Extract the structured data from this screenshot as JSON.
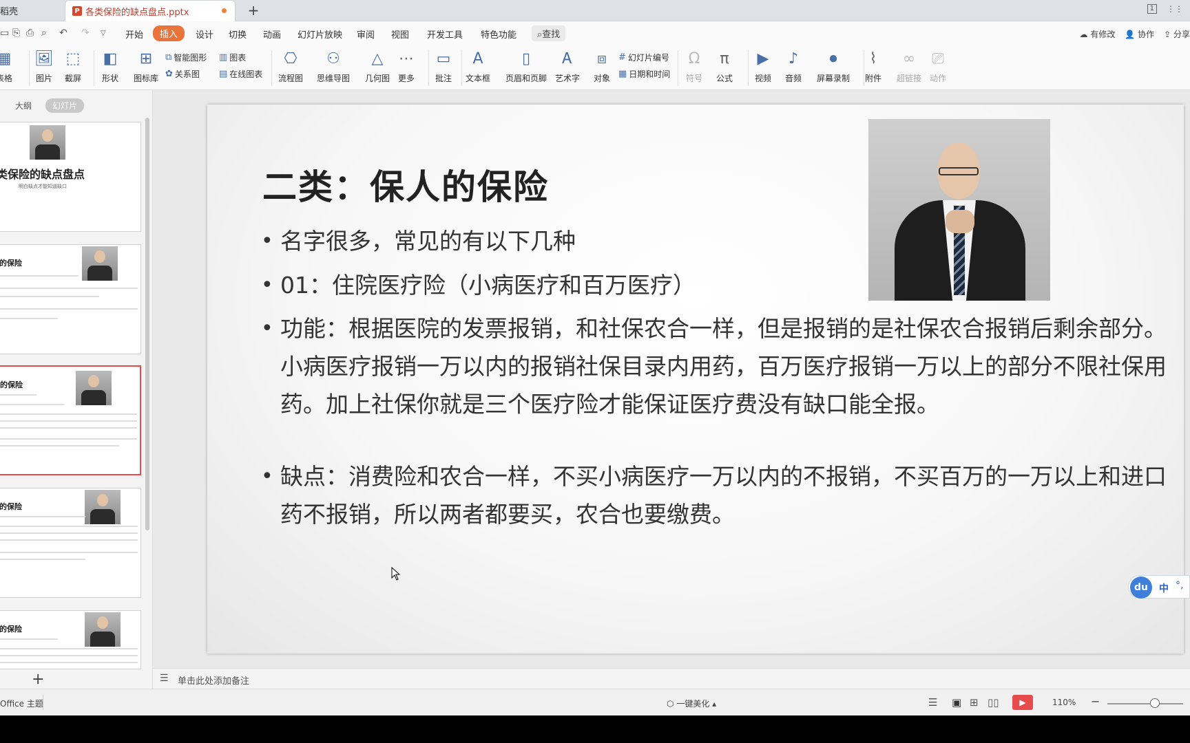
{
  "tabs": {
    "home": "稻壳",
    "doc": "各类保险的缺点盘点.pptx",
    "new": "+"
  },
  "menu": {
    "items": [
      "开始",
      "插入",
      "设计",
      "切换",
      "动画",
      "幻灯片放映",
      "审阅",
      "视图",
      "开发工具",
      "特色功能"
    ],
    "active": "插入",
    "search": "查找",
    "right": [
      "有修改",
      "协作",
      "分享"
    ]
  },
  "ribbon": {
    "table": "表格",
    "picture": "图片",
    "screenshot": "截屏",
    "shape": "形状",
    "iconlib": "图标库",
    "smartart": "智能图形",
    "chart": "图表",
    "relation": "关系图",
    "onlinechart": "在线图表",
    "flowchart": "流程图",
    "mindmap": "思维导图",
    "geometry": "几何图",
    "more": "更多",
    "comment": "批注",
    "textbox": "文本框",
    "headerfooter": "页眉和页脚",
    "wordart": "艺术字",
    "object": "对象",
    "slidenum": "幻灯片编号",
    "datetime": "日期和时间",
    "symbol": "符号",
    "formula": "公式",
    "video": "视频",
    "audio": "音频",
    "screenrec": "屏幕录制",
    "attach": "附件",
    "hyperlink": "超链接",
    "action": "动作"
  },
  "leftpanel": {
    "tab_outline": "大纲",
    "tab_slides": "幻灯片",
    "thumb1_title": "类保险的缺点盘点",
    "thumb1_sub": "明白缺点才能知道缺口",
    "thumb2_title": "的保险",
    "thumb3_title": "的保险",
    "thumb4_title": "的保险",
    "thumb5_title": "的保险",
    "add": "+"
  },
  "slide": {
    "title": "二类：保人的保险",
    "bullets": [
      "名字很多，常见的有以下几种",
      "01：住院医疗险（小病医疗和百万医疗）",
      "功能：根据医院的发票报销，和社保农合一样，但是报销的是社保农合报销后剩余部分。小病医疗报销一万以内的报销社保目录内用药，百万医疗报销一万以上的部分不限社保用药。加上社保你就是三个医疗险才能保证医疗费没有缺口能全报。",
      "缺点：消费险和农合一样，不买小病医疗一万以内的不报销，不买百万的一万以上和进口药不报销，所以两者都要买，农合也要缴费。"
    ]
  },
  "notes": {
    "placeholder": "单击此处添加备注"
  },
  "status": {
    "theme": "Office 主题",
    "beautify": "一键美化",
    "zoom": "110%"
  },
  "ime": {
    "logo": "du",
    "lang": "中",
    "punct": "°,"
  }
}
